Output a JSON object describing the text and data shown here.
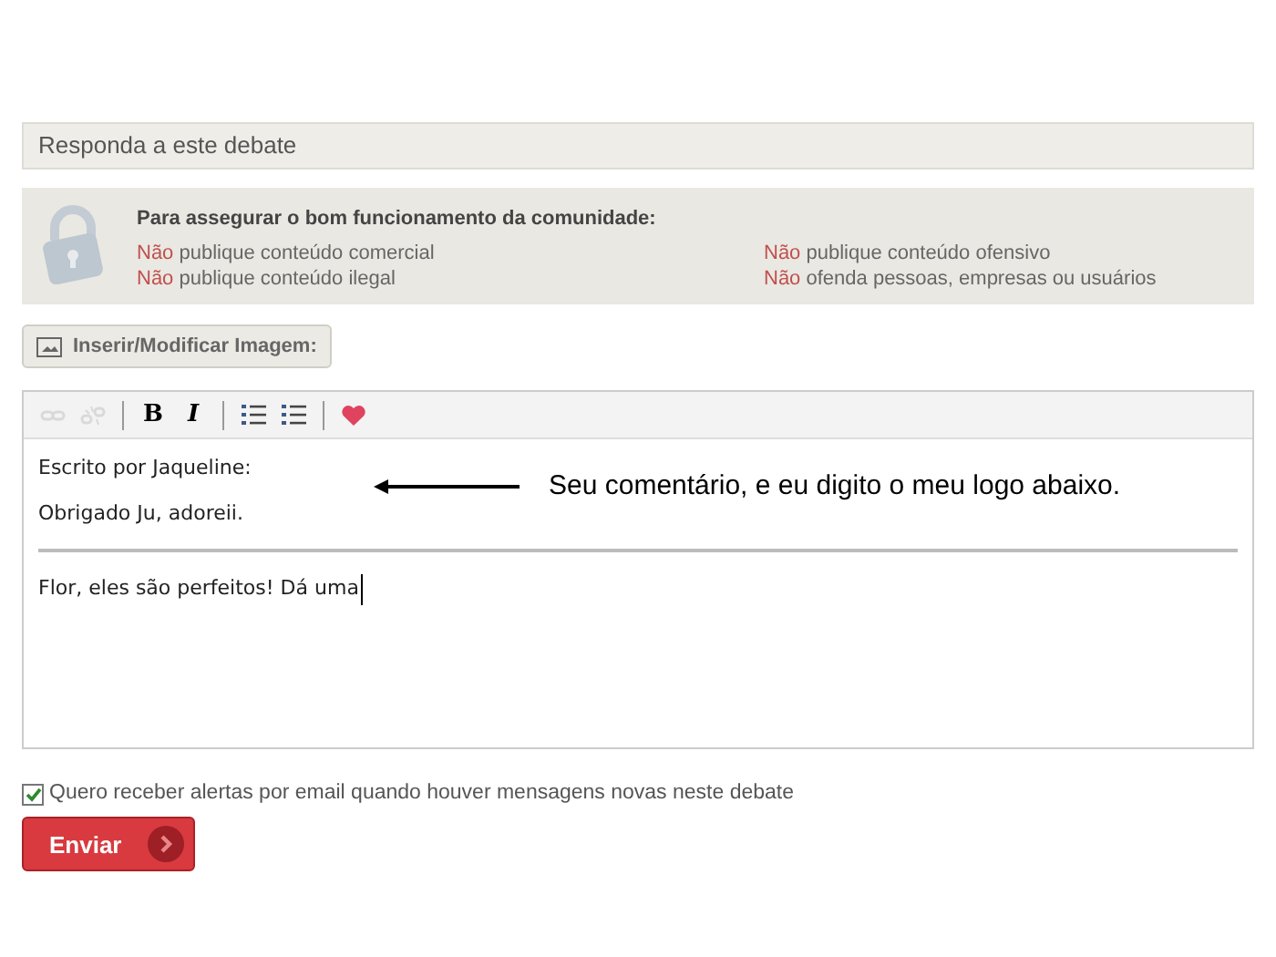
{
  "reply_header": {
    "title": "Responda a este debate"
  },
  "rules": {
    "heading": "Para assegurar o bom funcionamento da comunidade:",
    "items": [
      {
        "prefix": "Não",
        "text": "publique conteúdo comercial"
      },
      {
        "prefix": "Não",
        "text": "publique conteúdo ofensivo"
      },
      {
        "prefix": "Não",
        "text": "publique conteúdo ilegal"
      },
      {
        "prefix": "Não",
        "text": "ofenda pessoas, empresas ou usuários"
      }
    ]
  },
  "image_button": {
    "label": "Inserir/Modificar Imagem:"
  },
  "toolbar": [
    {
      "kind": "link",
      "disabled": true
    },
    {
      "kind": "unlink",
      "disabled": true
    },
    {
      "kind": "separator"
    },
    {
      "kind": "bold",
      "label": "B",
      "disabled": false
    },
    {
      "kind": "italic",
      "label": "I",
      "disabled": false
    },
    {
      "kind": "separator"
    },
    {
      "kind": "bullets",
      "disabled": false
    },
    {
      "kind": "numbers",
      "disabled": false
    },
    {
      "kind": "separator"
    },
    {
      "kind": "heart",
      "disabled": false
    }
  ],
  "editor": {
    "quote_lines": [
      "Escrito por Jaqueline:",
      "Obrigado Ju, adoreii."
    ],
    "value": "Flor, eles são perfeitos! Dá uma"
  },
  "annotation": {
    "text": "Seu comentário, e eu digito o meu logo abaixo."
  },
  "email_alerts": {
    "label": "Quero receber alertas por email quando houver mensagens novas neste debate",
    "checked": true
  },
  "submit": {
    "label": "Enviar"
  }
}
